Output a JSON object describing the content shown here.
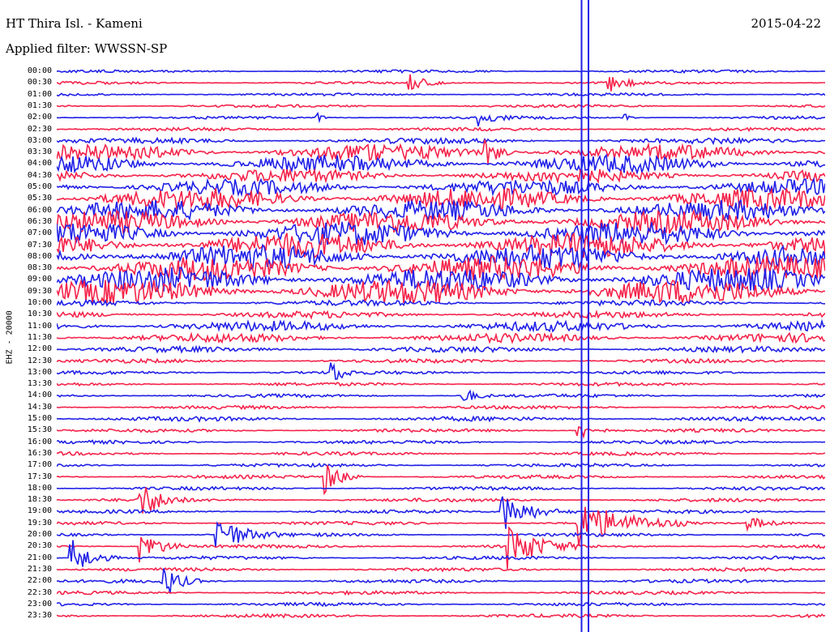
{
  "header": {
    "station": "HT Thira Isl. - Kameni",
    "date": "2015-04-22",
    "filter": "Applied filter: WWSSN-SP"
  },
  "channel_label": "EHZ - 20000",
  "colors": {
    "trace_a": "#2020e8",
    "trace_b": "#f5234a"
  },
  "time_labels": [
    "00:00",
    "00:30",
    "01:00",
    "01:30",
    "02:00",
    "02:30",
    "03:00",
    "03:30",
    "04:00",
    "04:30",
    "05:00",
    "05:30",
    "06:00",
    "06:30",
    "07:00",
    "07:30",
    "08:00",
    "08:30",
    "09:00",
    "09:30",
    "10:00",
    "10:30",
    "11:00",
    "11:30",
    "12:00",
    "12:30",
    "13:00",
    "13:30",
    "14:00",
    "14:30",
    "15:00",
    "15:30",
    "16:00",
    "16:30",
    "17:00",
    "17:30",
    "18:00",
    "18:30",
    "19:00",
    "19:30",
    "20:00",
    "20:30",
    "21:00",
    "21:30",
    "22:00",
    "22:30",
    "23:00",
    "23:30"
  ],
  "trace_noise": [
    0.25,
    0.25,
    0.25,
    0.25,
    0.25,
    0.3,
    0.5,
    1.4,
    1.6,
    1.2,
    1.4,
    1.9,
    1.8,
    2.0,
    2.1,
    2.2,
    2.2,
    2.2,
    2.2,
    2.2,
    0.5,
    0.6,
    0.9,
    0.8,
    0.5,
    0.35,
    0.3,
    0.3,
    0.3,
    0.3,
    0.4,
    0.3,
    0.3,
    0.3,
    0.3,
    0.3,
    0.3,
    0.3,
    0.3,
    0.3,
    0.3,
    0.3,
    0.3,
    0.3,
    0.3,
    0.3,
    0.3,
    0.3
  ],
  "events": [
    {
      "row": 1,
      "t": 0.46,
      "w": 0.03,
      "a": 1.4
    },
    {
      "row": 1,
      "t": 0.72,
      "w": 0.03,
      "a": 1.6
    },
    {
      "row": 4,
      "t": 0.34,
      "w": 0.01,
      "a": 1.2
    },
    {
      "row": 4,
      "t": 0.55,
      "w": 0.035,
      "a": 1.3
    },
    {
      "row": 4,
      "t": 0.74,
      "w": 0.01,
      "a": 1.0
    },
    {
      "row": 7,
      "t": 0.56,
      "w": 0.025,
      "a": 2.2
    },
    {
      "row": 26,
      "t": 0.36,
      "w": 0.02,
      "a": 2.0
    },
    {
      "row": 28,
      "t": 0.53,
      "w": 0.025,
      "a": 1.4
    },
    {
      "row": 31,
      "t": 0.68,
      "w": 0.03,
      "a": 1.6
    },
    {
      "row": 35,
      "t": 0.35,
      "w": 0.03,
      "a": 3.0
    },
    {
      "row": 37,
      "t": 0.11,
      "w": 0.04,
      "a": 3.2
    },
    {
      "row": 38,
      "t": 0.58,
      "w": 0.06,
      "a": 3.5
    },
    {
      "row": 39,
      "t": 0.68,
      "w": 0.09,
      "a": 4.0
    },
    {
      "row": 39,
      "t": 0.9,
      "w": 0.05,
      "a": 1.2
    },
    {
      "row": 40,
      "t": 0.21,
      "w": 0.05,
      "a": 3.4
    },
    {
      "row": 41,
      "t": 0.11,
      "w": 0.04,
      "a": 3.0
    },
    {
      "row": 41,
      "t": 0.59,
      "w": 0.06,
      "a": 3.8
    },
    {
      "row": 42,
      "t": 0.02,
      "w": 0.04,
      "a": 3.4
    },
    {
      "row": 44,
      "t": 0.14,
      "w": 0.03,
      "a": 3.0
    }
  ],
  "spike": {
    "t_start": 0.683,
    "t_end": 0.692
  }
}
